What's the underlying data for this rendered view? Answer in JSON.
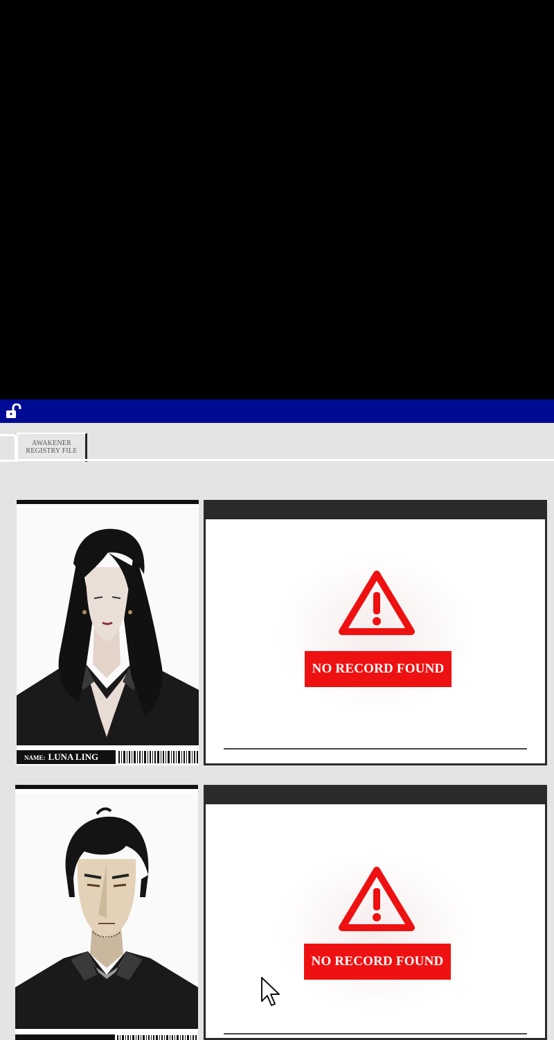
{
  "window": {
    "tab_label_line1": "AWAKENER",
    "tab_label_line2": "REGISTRY FILE"
  },
  "records": [
    {
      "name_key": "NAME:",
      "name_value": "LUNA LING",
      "status": "NO RECORD FOUND",
      "portrait": "long-haired-figure-portrait"
    },
    {
      "name_key": "",
      "name_value": "",
      "status": "NO RECORD FOUND",
      "portrait": "short-haired-man-portrait"
    }
  ],
  "colors": {
    "titlebar": "#000b94",
    "warning_red": "#ee1111",
    "window_bg": "#e4e4e4"
  },
  "icons": {
    "titlebar": "unlocked-padlock-icon",
    "warning": "warning-triangle-icon",
    "pointer": "mouse-cursor-icon"
  }
}
